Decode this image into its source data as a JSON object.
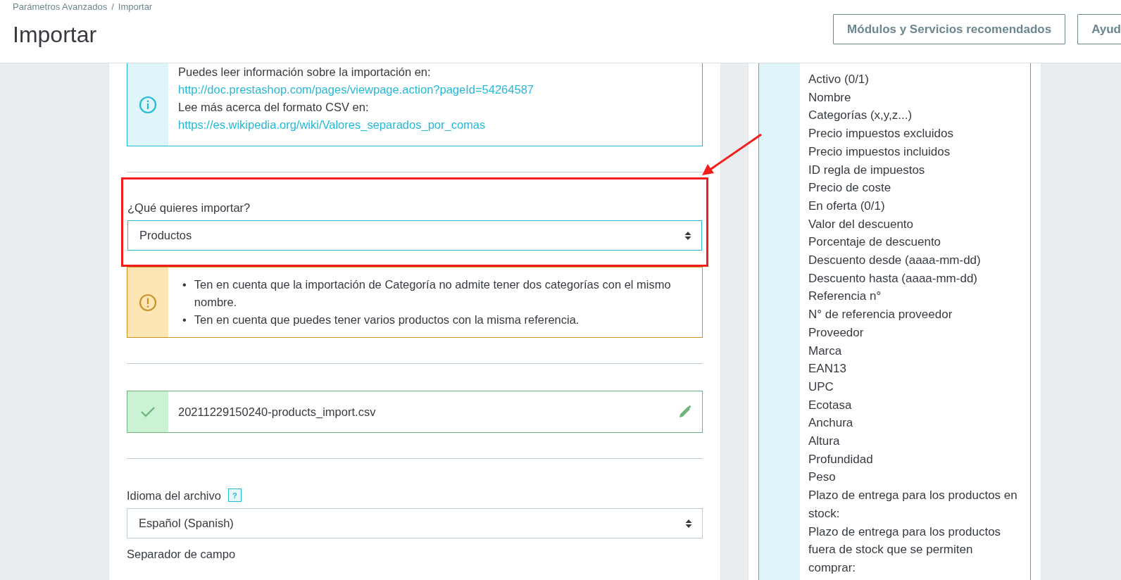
{
  "breadcrumb": [
    "Parámetros Avanzados",
    "Importar"
  ],
  "breadcrumb_separator": "/",
  "title": "Importar",
  "header_buttons": [
    "Módulos y Servicios recomendados",
    "Ayud"
  ],
  "info_alert": {
    "lines": [
      {
        "kind": "text",
        "text": "Puedes leer información sobre la importación en:"
      },
      {
        "kind": "link",
        "text": "http://doc.prestashop.com/pages/viewpage.action?pageId=54264587"
      },
      {
        "kind": "text",
        "text": "Lee más acerca del formato CSV en:"
      },
      {
        "kind": "link",
        "text": "https://es.wikipedia.org/wiki/Valores_separados_por_comas"
      }
    ]
  },
  "import_select": {
    "label": "¿Qué quieres importar?",
    "value": "Productos",
    "highlighted": true
  },
  "warning_alert": {
    "bullet": "•",
    "items": [
      "Ten en cuenta que la importación de Categoría no admite tener dos categorías con el mismo nombre.",
      "Ten en cuenta que puedes tener varios productos con la misma referencia."
    ]
  },
  "file_alert": {
    "file_name": "20211229150240-products_import.csv"
  },
  "language_select": {
    "label": "Idioma del archivo",
    "help": "?",
    "value": "Español (Spanish)"
  },
  "field_separator": {
    "label": "Separador de campo"
  },
  "available_fields": [
    "Activo (0/1)",
    "Nombre",
    "Categorías (x,y,z...)",
    "Precio impuestos excluidos",
    "Precio impuestos incluidos",
    "ID regla de impuestos",
    "Precio de coste",
    "En oferta (0/1)",
    "Valor del descuento",
    "Porcentaje de descuento",
    "Descuento desde (aaaa-mm-dd)",
    "Descuento hasta (aaaa-mm-dd)",
    "Referencia n°",
    "N° de referencia proveedor",
    "Proveedor",
    "Marca",
    "EAN13",
    "UPC",
    "Ecotasa",
    "Anchura",
    "Altura",
    "Profundidad",
    "Peso",
    "Plazo de entrega para los productos en stock:",
    "Plazo de entrega para los productos fuera de stock que se permiten comprar:"
  ]
}
